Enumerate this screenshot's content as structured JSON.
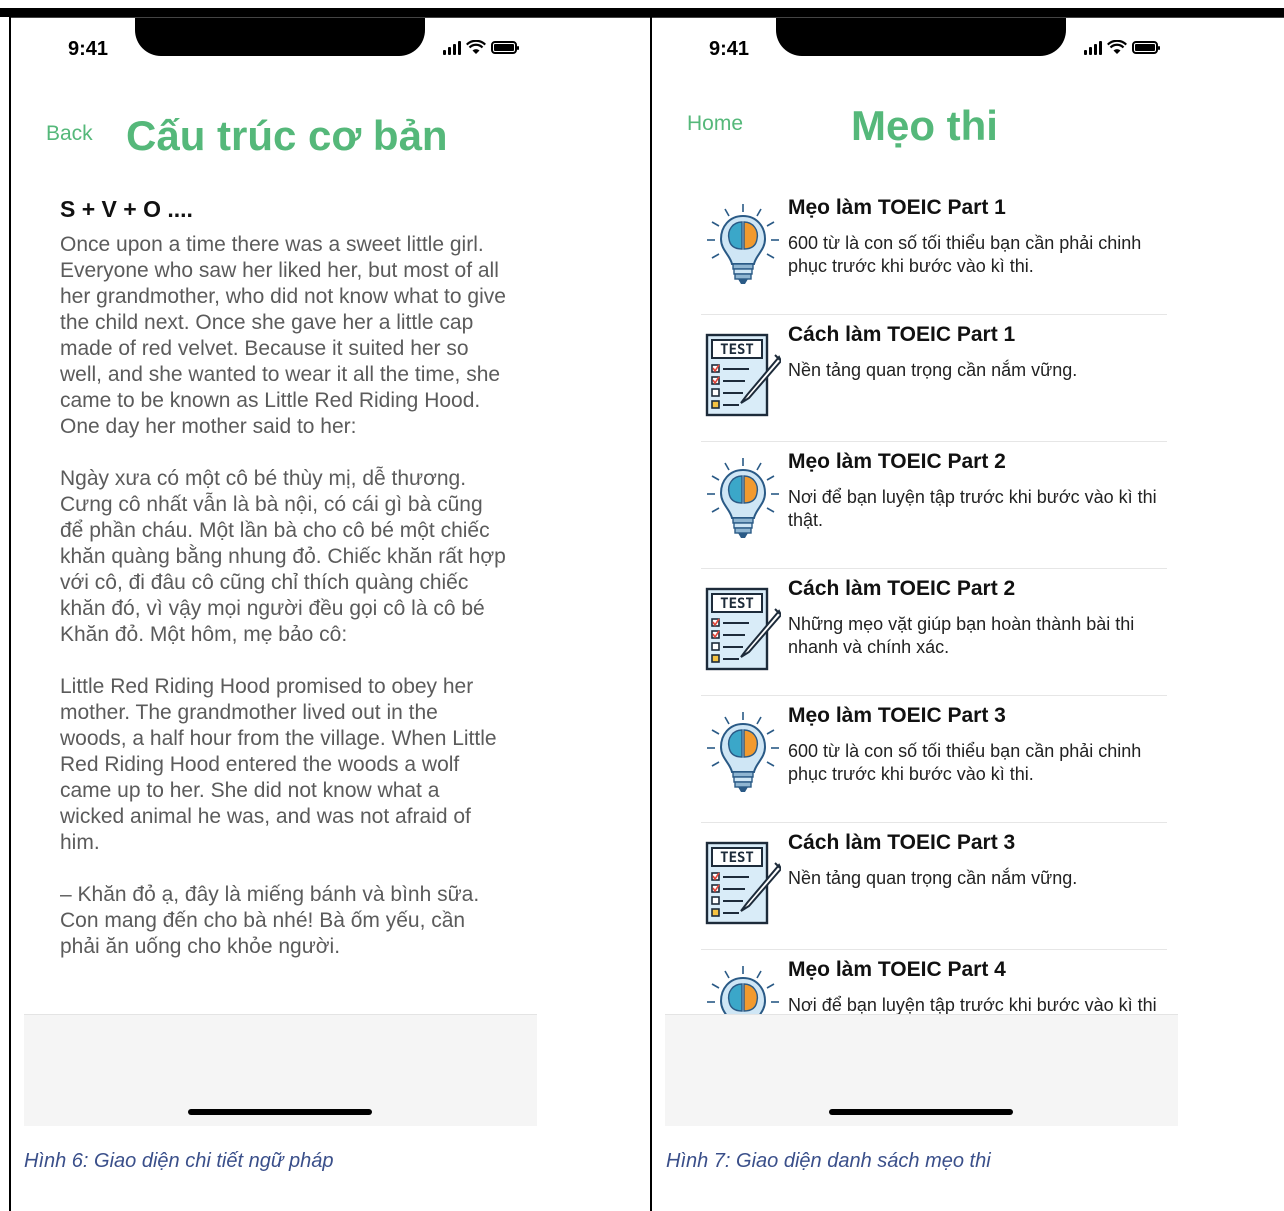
{
  "left_screen": {
    "status_time": "9:41",
    "back_label": "Back",
    "title": "Cấu trúc cơ bản",
    "formula": "S + V + O ....",
    "paragraphs": [
      "Once upon a time there was a sweet little girl. Everyone who saw her liked her, but most of all her grandmother, who did not know what to give the child next. Once she gave her a little cap made of red velvet. Because it suited her so well, and she wanted to wear it all the time, she came to be known as Little Red Riding Hood. One day her mother said to her:",
      "Ngày xưa có một cô bé thùy mị, dễ thương. Cưng cô nhất vẫn là bà nội, có cái gì bà cũng để phần cháu. Một lần bà cho cô bé một chiếc khăn quàng bằng nhung đỏ. Chiếc khăn rất hợp với cô, đi đâu cô cũng chỉ thích quàng chiếc khăn đó, vì vậy mọi người đều gọi cô là cô bé Khăn đỏ. Một hôm, mẹ bảo cô:",
      "Little Red Riding Hood promised to obey her mother. The grandmother lived out in the woods, a half hour from the village. When Little Red Riding Hood entered the woods a wolf came up to her. She did not know what a wicked animal he was, and was not afraid of him.",
      "– Khăn đỏ ạ, đây là miếng bánh và bình sữa. Con mang đến cho bà nhé! Bà ốm yếu, cần phải ăn uống cho khỏe người."
    ],
    "caption": "Hình 6: Giao diện chi tiết ngữ pháp"
  },
  "right_screen": {
    "status_time": "9:41",
    "home_label": "Home",
    "title": "Mẹo thi",
    "items": [
      {
        "icon": "lightbulb-brain-icon",
        "title": "Mẹo làm TOEIC Part 1",
        "desc": "600 từ là con số tối thiểu bạn cần phải chinh phục trước khi bước vào kì thi."
      },
      {
        "icon": "test-sheet-icon",
        "title": "Cách làm TOEIC Part 1",
        "desc": "Nền tảng quan trọng cần nắm vững."
      },
      {
        "icon": "lightbulb-brain-icon",
        "title": "Mẹo làm TOEIC Part 2",
        "desc": "Nơi để bạn luyện tập trước khi bước vào kì thi thật."
      },
      {
        "icon": "test-sheet-icon",
        "title": "Cách làm TOEIC Part 2",
        "desc": "Những mẹo vặt giúp bạn hoàn thành bài thi nhanh và chính xác."
      },
      {
        "icon": "lightbulb-brain-icon",
        "title": "Mẹo làm TOEIC Part 3",
        "desc": "600 từ là con số tối thiểu bạn cần phải chinh phục trước khi bước vào kì thi."
      },
      {
        "icon": "test-sheet-icon",
        "title": "Cách làm TOEIC Part 3",
        "desc": "Nền tảng quan trọng cần nắm vững."
      },
      {
        "icon": "lightbulb-brain-icon",
        "title": "Mẹo làm TOEIC Part 4",
        "desc": "Nơi để bạn luyện tập trước khi bước vào kì thi thật."
      }
    ],
    "test_label": "TEST",
    "caption": "Hình 7: Giao diện danh sách mẹo thi"
  },
  "colors": {
    "accent": "#55b87a",
    "caption": "#3a4f8a",
    "body_text": "#5b5b5b"
  }
}
